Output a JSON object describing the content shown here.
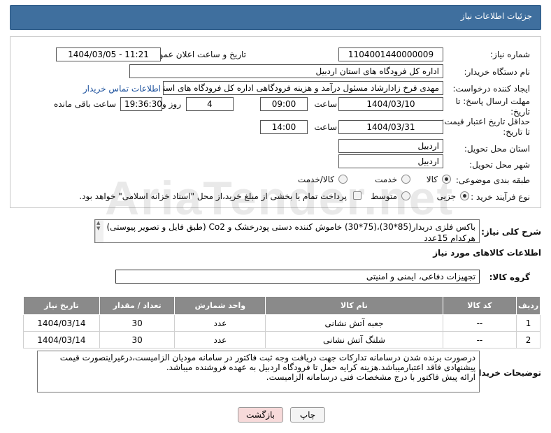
{
  "header": {
    "title": "جزئیات اطلاعات نیاز"
  },
  "watermark": {
    "text": "AriaTender.net"
  },
  "fields": {
    "need_number": {
      "label": "شماره نیاز:",
      "value": "1104001440000009"
    },
    "announce_date": {
      "label": "تاریخ و ساعت اعلان عمومی:",
      "value": "1404/03/05 - 11:21"
    },
    "buyer_org": {
      "label": "نام دستگاه خریدار:",
      "value": "اداره کل فرودگاه های استان اردبیل"
    },
    "creator": {
      "label": "ایجاد کننده درخواست:",
      "value": "مهدی فرخ زادارشاد مسئول درآمد و هزینه فرودگاهی اداره کل فرودگاه های استان",
      "link": "اطلاعات تماس خریدار"
    },
    "reply_deadline": {
      "label_line1": "مهلت ارسال پاسخ: تا",
      "label_line2": "تاریخ:",
      "date": "1404/03/10",
      "time_label": "ساعت",
      "time": "09:00",
      "days": "4",
      "days_label": "روز و",
      "remaining": "19:36:30",
      "remaining_label": "ساعت باقی مانده"
    },
    "price_validity": {
      "label_line1": "حداقل تاریخ اعتبار قیمت:",
      "label_line2": "تا تاریخ:",
      "date": "1404/03/31",
      "time_label": "ساعت",
      "time": "14:00"
    },
    "province": {
      "label": "استان محل تحویل:",
      "value": "اردبیل"
    },
    "city": {
      "label": "شهر محل تحویل:",
      "value": "اردبیل"
    },
    "category": {
      "label": "طبقه بندی موضوعی:",
      "options": [
        "کالا",
        "خدمت",
        "کالا/خدمت"
      ],
      "selected": "کالا"
    },
    "purchase_type": {
      "label": "نوع فرآیند خرید :",
      "options": [
        "جزیی",
        "متوسط"
      ],
      "selected": "جزیی",
      "treasury_note": "پرداخت تمام یا بخشی از مبلغ خرید،از محل \"اسناد خزانه اسلامی\" خواهد بود."
    }
  },
  "description": {
    "label": "شرح کلی نیاز:",
    "line1": "باکس فلزی دربدار(85*30)،(75*30) خاموش کننده دستی پودرخشک و Co2 (طبق فایل و تصویر پیوستی)",
    "line2": "هرکدام 15عدد"
  },
  "goods_info": {
    "title": "اطلاعات کالاهای مورد نیاز"
  },
  "goods_group": {
    "label": "گروه کالا:",
    "value": "تجهیزات دفاعی، ایمنی و امنیتی"
  },
  "table": {
    "headers": [
      "ردیف",
      "کد کالا",
      "نام کالا",
      "واحد شمارش",
      "تعداد / مقدار",
      "تاریخ نیاز"
    ],
    "rows": [
      [
        "1",
        "--",
        "جعبه آتش نشانی",
        "عدد",
        "30",
        "1404/03/14"
      ],
      [
        "2",
        "--",
        "شلنگ آتش نشانی",
        "عدد",
        "30",
        "1404/03/14"
      ]
    ]
  },
  "buyer_notes": {
    "label": "توضیحات خریدار:",
    "lines": [
      "درصورت برنده شدن درسامانه تدارکات جهت دریافت وجه ثبت فاکتور در سامانه مودیان الزامیست،درغیراینصورت قیمت",
      "پیشنهادی فاقد اعتبارمیباشد.هزینه کرایه حمل تا فرودگاه اردبیل به عهده فروشنده میباشد.",
      "ارائه پیش فاکتور با درج مشخصات فنی درسامانه الزامیست."
    ]
  },
  "buttons": {
    "print": "چاپ",
    "back": "بازگشت"
  },
  "colors": {
    "header": "#3f6f9e",
    "table_header": "#8a8a8a",
    "back_button": "#f7dada",
    "link": "#1a4f9c"
  }
}
